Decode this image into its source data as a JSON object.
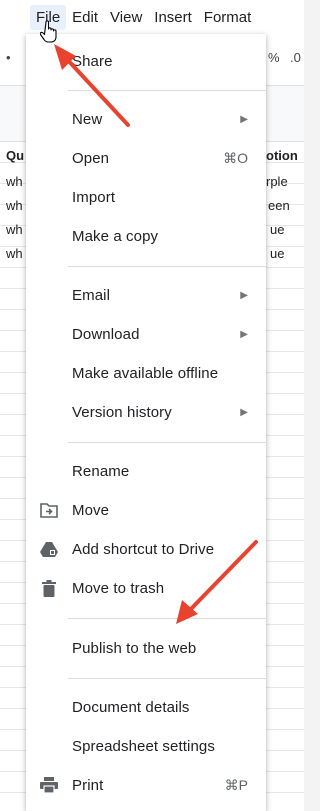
{
  "menubar": {
    "items": [
      {
        "label": "File"
      },
      {
        "label": "Edit"
      },
      {
        "label": "View"
      },
      {
        "label": "Insert"
      },
      {
        "label": "Format"
      }
    ]
  },
  "toolbar": {
    "left_glyph": "•",
    "percent": "%",
    "decimal": ".0"
  },
  "grid": {
    "left_header": "Qu",
    "left_cells": [
      "wh",
      "wh",
      "wh",
      "wh"
    ],
    "right_header": "otion",
    "right_cells": [
      "rple",
      "een",
      "ue",
      "ue"
    ]
  },
  "menu": {
    "items": [
      {
        "label": "Share"
      },
      {
        "label": "New"
      },
      {
        "label": "Open",
        "shortcut": "⌘O"
      },
      {
        "label": "Import"
      },
      {
        "label": "Make a copy"
      },
      {
        "label": "Email"
      },
      {
        "label": "Download"
      },
      {
        "label": "Make available offline"
      },
      {
        "label": "Version history"
      },
      {
        "label": "Rename"
      },
      {
        "label": "Move"
      },
      {
        "label": "Add shortcut to Drive"
      },
      {
        "label": "Move to trash"
      },
      {
        "label": "Publish to the web"
      },
      {
        "label": "Document details"
      },
      {
        "label": "Spreadsheet settings"
      },
      {
        "label": "Print",
        "shortcut": "⌘P"
      }
    ],
    "submenu_arrow": "▶"
  },
  "colors": {
    "annotation_arrow": "#e8432f",
    "menu_bg": "#ffffff",
    "active_menu_bg": "#e8f0fe"
  },
  "icons": {
    "move": "move-to-folder-icon",
    "shortcut": "drive-shortcut-icon",
    "trash": "trash-icon",
    "print": "printer-icon",
    "cursor": "hand-cursor-icon"
  }
}
